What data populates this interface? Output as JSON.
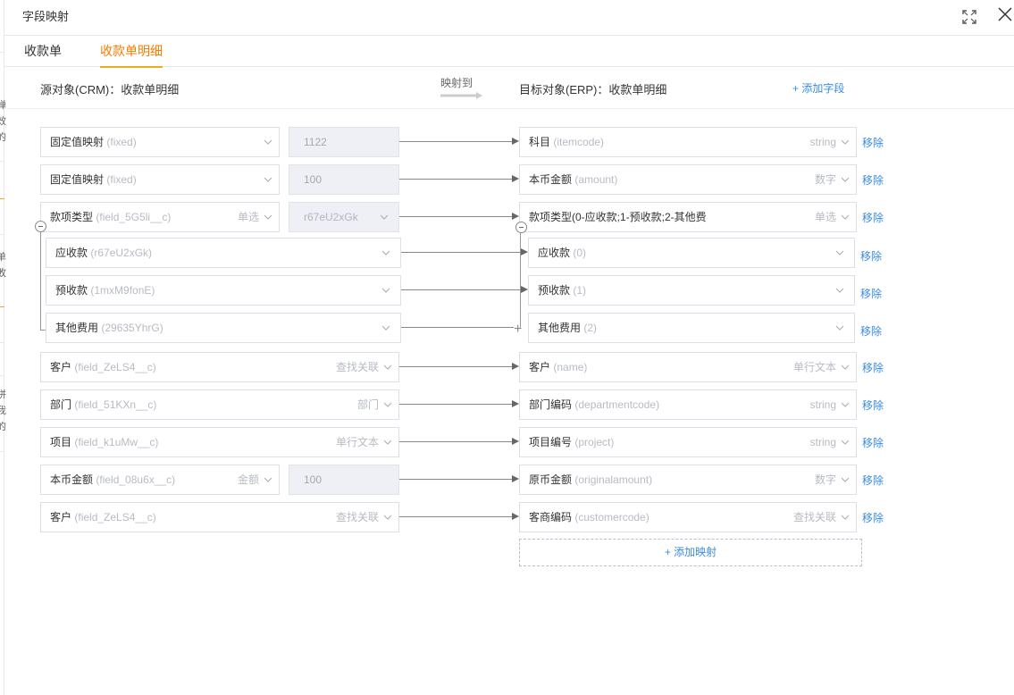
{
  "dialog": {
    "title": "字段映射"
  },
  "tabs": [
    "收款单",
    "收款单明细"
  ],
  "header": {
    "source_title": "源对象(CRM)：收款单明细",
    "map_to": "映射到",
    "target_title": "目标对象(ERP)：收款单明细",
    "add_field": "+ 添加字段"
  },
  "remove_label": "移除",
  "add_mapping": "+ 添加映射",
  "left_strip": [
    "弹",
    "效",
    "的",
    "单",
    "敗",
    "拼",
    "我",
    "的"
  ],
  "rows": [
    {
      "src_label": "固定值映射",
      "src_api": "(fixed)",
      "src_type": "",
      "value": "1122",
      "tgt_label": "科目",
      "tgt_api": "(itemcode)",
      "tgt_type": "string"
    },
    {
      "src_label": "固定值映射",
      "src_api": "(fixed)",
      "src_type": "",
      "value": "100",
      "tgt_label": "本币金额",
      "tgt_api": "(amount)",
      "tgt_type": "数字"
    },
    {
      "src_label": "款项类型",
      "src_api": "(field_5G5li__c)",
      "src_type": "单选",
      "value": "r67eU2xGk",
      "tgt_label": "款项类型(0-应收款;1-预收款;2-其他费",
      "tgt_api": "",
      "tgt_type": "单选"
    },
    {
      "src_label": "客户",
      "src_api": "(field_ZeLS4__c)",
      "src_type": "查找关联",
      "value": "",
      "tgt_label": "客户",
      "tgt_api": "(name)",
      "tgt_type": "单行文本"
    },
    {
      "src_label": "部门",
      "src_api": "(field_51KXn__c)",
      "src_type": "部门",
      "value": "",
      "tgt_label": "部门编码",
      "tgt_api": "(departmentcode)",
      "tgt_type": "string"
    },
    {
      "src_label": "项目",
      "src_api": "(field_k1uMw__c)",
      "src_type": "单行文本",
      "value": "",
      "tgt_label": "项目编号",
      "tgt_api": "(project)",
      "tgt_type": "string"
    },
    {
      "src_label": "本币金额",
      "src_api": "(field_08u6x__c)",
      "src_type": "金额",
      "value": "100",
      "tgt_label": "原币金额",
      "tgt_api": "(originalamount)",
      "tgt_type": "数字"
    },
    {
      "src_label": "客户",
      "src_api": "(field_ZeLS4__c)",
      "src_type": "查找关联",
      "value": "",
      "tgt_label": "客商编码",
      "tgt_api": "(customercode)",
      "tgt_type": "查找关联"
    }
  ],
  "options": [
    {
      "src_label": "应收款",
      "src_api": "(r67eU2xGk)",
      "tgt_label": "应收款",
      "tgt_api": "(0)"
    },
    {
      "src_label": "预收款",
      "src_api": "(1mxM9fonE)",
      "tgt_label": "预收款",
      "tgt_api": "(1)"
    },
    {
      "src_label": "其他费用",
      "src_api": "(29635YhrG)",
      "tgt_label": "其他费用",
      "tgt_api": "(2)"
    }
  ]
}
